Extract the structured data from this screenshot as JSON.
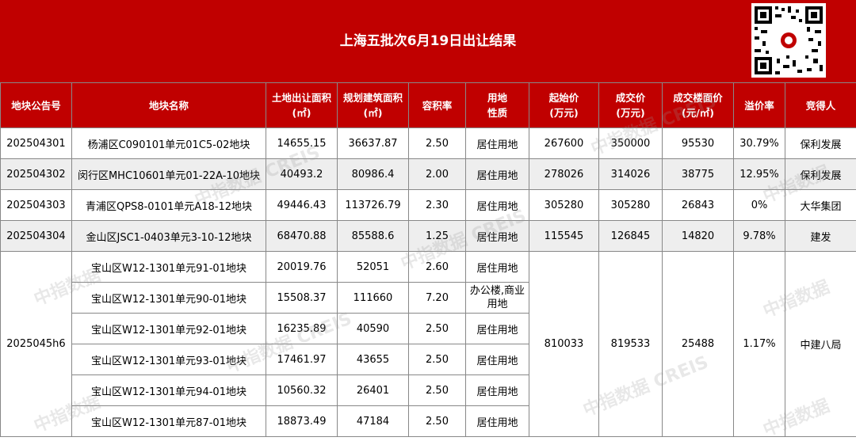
{
  "title": "上海五批次6月19日出让结果",
  "watermark": {
    "cn": "中指数据",
    "en": "CREIS"
  },
  "colors": {
    "header": "#c00000",
    "shade": "#eeeeee"
  },
  "headers": {
    "code": "地块公告号",
    "name": "地块名称",
    "area1": "土地出让面积",
    "area2": "(㎡)",
    "build1": "规划建筑面积",
    "build2": "(㎡)",
    "far": "容积率",
    "use1": "用地",
    "use2": "性质",
    "start1": "起始价",
    "start2": "(万元)",
    "deal1": "成交价",
    "deal2": "(万元)",
    "floor1": "成交楼面价",
    "floor2": "(元/㎡)",
    "premium": "溢价率",
    "bidder": "竞得人"
  },
  "rows": [
    {
      "code": "202504301",
      "name": "杨浦区C090101单元01C5-02地块",
      "area": "14655.15",
      "build": "36637.87",
      "far": "2.50",
      "use": "居住用地",
      "start": "267600",
      "deal": "350000",
      "floor": "95530",
      "premium": "30.79%",
      "bidder": "保利发展"
    },
    {
      "code": "202504302",
      "name": "闵行区MHC10601单元01-22A-10地块",
      "area": "40493.2",
      "build": "80986.4",
      "far": "2.00",
      "use": "居住用地",
      "start": "278026",
      "deal": "314026",
      "floor": "38775",
      "premium": "12.95%",
      "bidder": "保利发展"
    },
    {
      "code": "202504303",
      "name": "青浦区QPS8-0101单元A18-12地块",
      "area": "49446.43",
      "build": "113726.79",
      "far": "2.30",
      "use": "居住用地",
      "start": "305280",
      "deal": "305280",
      "floor": "26843",
      "premium": "0%",
      "bidder": "大华集团"
    },
    {
      "code": "202504304",
      "name": "金山区JSC1-0403单元3-10-12地块",
      "area": "68470.88",
      "build": "85588.6",
      "far": "1.25",
      "use": "居住用地",
      "start": "115545",
      "deal": "126845",
      "floor": "14820",
      "premium": "9.78%",
      "bidder": "建发"
    }
  ],
  "group": {
    "code": "2025045h6",
    "start": "810033",
    "deal": "819533",
    "floor": "25488",
    "premium": "1.17%",
    "bidder": "中建八局",
    "parcels": [
      {
        "name": "宝山区W12-1301单元91-01地块",
        "area": "20019.76",
        "build": "52051",
        "far": "2.60",
        "use": "居住用地"
      },
      {
        "name": "宝山区W12-1301单元90-01地块",
        "area": "15508.37",
        "build": "111660",
        "far": "7.20",
        "use": "办公楼,商业用地"
      },
      {
        "name": "宝山区W12-1301单元92-01地块",
        "area": "16235.89",
        "build": "40590",
        "far": "2.50",
        "use": "居住用地"
      },
      {
        "name": "宝山区W12-1301单元93-01地块",
        "area": "17461.97",
        "build": "43655",
        "far": "2.50",
        "use": "居住用地"
      },
      {
        "name": "宝山区W12-1301单元94-01地块",
        "area": "10560.32",
        "build": "26401",
        "far": "2.50",
        "use": "居住用地"
      },
      {
        "name": "宝山区W12-1301单元87-01地块",
        "area": "18873.49",
        "build": "47184",
        "far": "2.50",
        "use": "居住用地"
      }
    ]
  }
}
